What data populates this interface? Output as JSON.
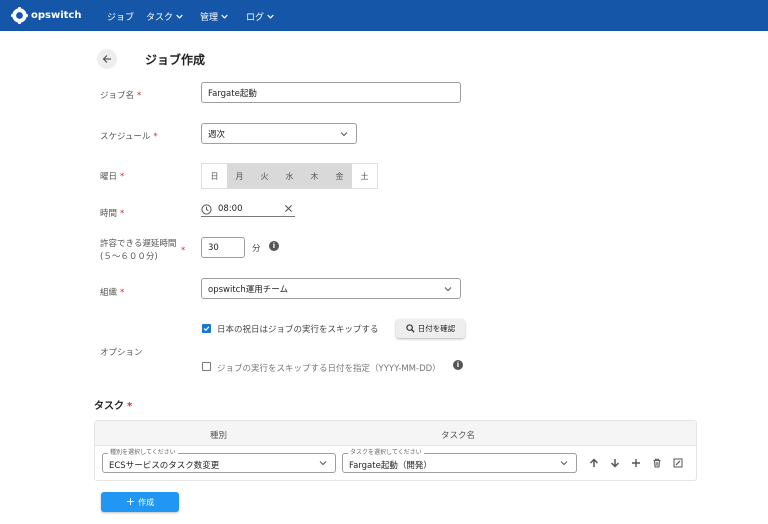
{
  "header": {
    "logo_text": "opswitch",
    "nav": [
      {
        "label": "ジョブ",
        "dropdown": false
      },
      {
        "label": "タスク",
        "dropdown": true
      },
      {
        "label": "管理",
        "dropdown": true
      },
      {
        "label": "ログ",
        "dropdown": true
      }
    ]
  },
  "page": {
    "title": "ジョブ作成"
  },
  "form": {
    "required_mark": "*",
    "job_name": {
      "label": "ジョブ名",
      "value": "Fargate起動"
    },
    "schedule": {
      "label": "スケジュール",
      "value": "週次"
    },
    "weekday": {
      "label": "曜日",
      "days": [
        {
          "label": "日",
          "selected": false
        },
        {
          "label": "月",
          "selected": true
        },
        {
          "label": "火",
          "selected": true
        },
        {
          "label": "水",
          "selected": true
        },
        {
          "label": "木",
          "selected": true
        },
        {
          "label": "金",
          "selected": true
        },
        {
          "label": "土",
          "selected": false
        }
      ]
    },
    "time": {
      "label": "時間",
      "value": "08:00"
    },
    "delay": {
      "label": "許容できる遅延時間",
      "hint": "(５～６００分)",
      "value": "30",
      "unit": "分"
    },
    "org": {
      "label": "組織",
      "value": "opswitch運用チーム"
    },
    "options": {
      "label": "オプション",
      "skip_holidays": {
        "label": "日本の祝日はジョブの実行をスキップする",
        "checked": true
      },
      "check_dates_button": "日付を確認",
      "skip_dates": {
        "label": "ジョブの実行をスキップする日付を指定（YYYY-MM-DD）",
        "checked": false
      }
    }
  },
  "tasks": {
    "title": "タスク",
    "columns": [
      "種別",
      "タスク名"
    ],
    "rows": [
      {
        "type_placeholder": "種別を選択してください",
        "type_value": "ECSサービスのタスク数変更",
        "name_placeholder": "タスクを選択してください",
        "name_value": "Fargate起動（開発）"
      }
    ]
  },
  "create_button": "作成",
  "colors": {
    "header_bg": "#1556a8",
    "accent": "#2196f3",
    "required": "#d32f2f",
    "checkbox": "#1976d2"
  }
}
